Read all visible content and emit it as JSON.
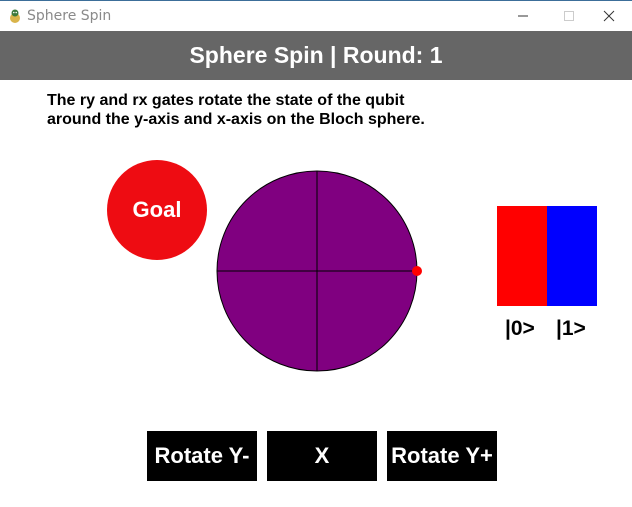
{
  "window": {
    "title": "Sphere Spin",
    "icon": "pygame-snake-icon"
  },
  "header": {
    "title": "Sphere Spin | Round: 1"
  },
  "instructions": {
    "line1": "The ry and rx gates rotate the state of the qubit",
    "line2": "around the y-axis and x-axis on the Bloch sphere."
  },
  "goal": {
    "label": "Goal",
    "color": "#ee0c12"
  },
  "bloch_sphere": {
    "color": "#800080",
    "state_marker_color": "#ff0000"
  },
  "probabilities": {
    "zero_label": "|0>",
    "one_label": "|1>",
    "zero_color": "#ff0000",
    "one_color": "#0000ff"
  },
  "controls": {
    "rotate_y_minus": "Rotate Y-",
    "x_gate": "X",
    "rotate_y_plus": "Rotate Y+"
  }
}
